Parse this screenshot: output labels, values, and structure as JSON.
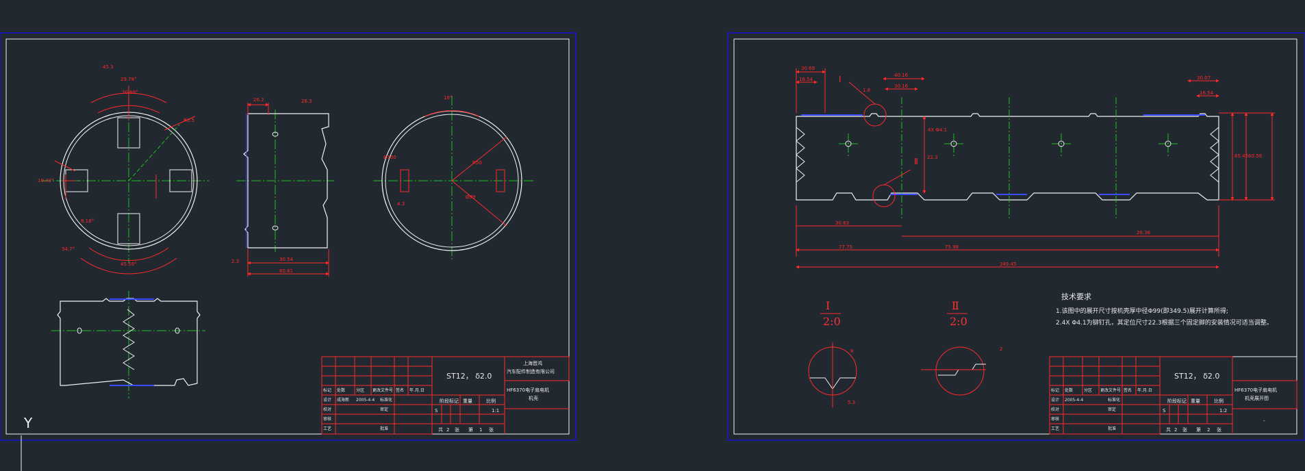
{
  "colors": {
    "background": "#212830",
    "frame": "#1a1aa8",
    "geometry": "#f2f2f2",
    "dimension": "#ff2a2a",
    "centerline": "#1fbf1f",
    "hidden": "#3a4cff"
  },
  "sheets": [
    {
      "title_block": {
        "spec": "ST12， δ2.0",
        "company_line1": "上海晋鸿",
        "company_line2": "汽车配件制造有限公司",
        "part_name_line1": "HF6370电子扇电机",
        "part_name_line2": "机壳",
        "scale": "1:1",
        "sheet_info": [
          "共",
          "2",
          "张",
          "第",
          "1",
          "张"
        ],
        "rev_headers": [
          "标记",
          "处数",
          "分区",
          "更改文件号",
          "签名",
          "年.月.日"
        ],
        "role_labels": [
          "设计",
          "校对",
          "审核",
          "工艺"
        ],
        "role_values": [
          "成海新",
          "2005-4-4",
          "标准化",
          "审定",
          "批准"
        ],
        "stage_labels": [
          "阶段标记",
          "重量",
          "比例"
        ],
        "stage_mark": "S"
      },
      "dimensions": [
        "29.78°",
        "30.69°",
        "45.3",
        "19.43°",
        "34.7°",
        "8.18°",
        "45.59°",
        "R0.5",
        "26.2",
        "26.3",
        "30.54",
        "60.61",
        "2.3",
        "18°",
        "R50",
        "Ø99",
        "Ø100",
        "4.3"
      ]
    },
    {
      "title_block": {
        "spec": "ST12， δ2.0",
        "part_name_line1": "HF6370电子扇电机",
        "part_name_line2": "机壳展开图",
        "scale": "1:2",
        "sheet_info": [
          "共",
          "2",
          "张",
          "第",
          "2",
          "张"
        ],
        "rev_headers": [
          "标记",
          "处数",
          "分区",
          "更改文件号",
          "签名",
          "年.月.日"
        ],
        "role_labels": [
          "设计",
          "校对",
          "审核",
          "工艺"
        ],
        "role_values": [
          "2005-4-4",
          "标准化",
          "审定",
          "批准"
        ],
        "stage_labels": [
          "阶段标记",
          "重量",
          "比例"
        ],
        "stage_mark": "S",
        "bottom_mark": "-"
      },
      "tech_req_title": "技术要求",
      "tech_req_items": [
        "1.该图中的展开尺寸按机壳厚中径Φ99(即349.5)展开计算所得;",
        "2.4X Φ4.1为铆钉孔，其定位尺寸22.3根据三个固定脚的安装情况可适当调整。"
      ],
      "section_labels": [
        "Ⅰ",
        "2:0",
        "Ⅱ",
        "2:0"
      ],
      "callouts": [
        "Ⅰ",
        "Ⅱ"
      ],
      "dimensions": [
        "30.69",
        "16.54",
        "40.16",
        "30.16",
        "1.8",
        "30.07",
        "16.54",
        "4X Φ4.1",
        "22.3",
        "65.45",
        "60.58",
        "77.75",
        "75.98",
        "26.36",
        "349.45",
        "30.63",
        "8",
        "2",
        "5.3"
      ]
    }
  ],
  "ucs_label": "Y"
}
